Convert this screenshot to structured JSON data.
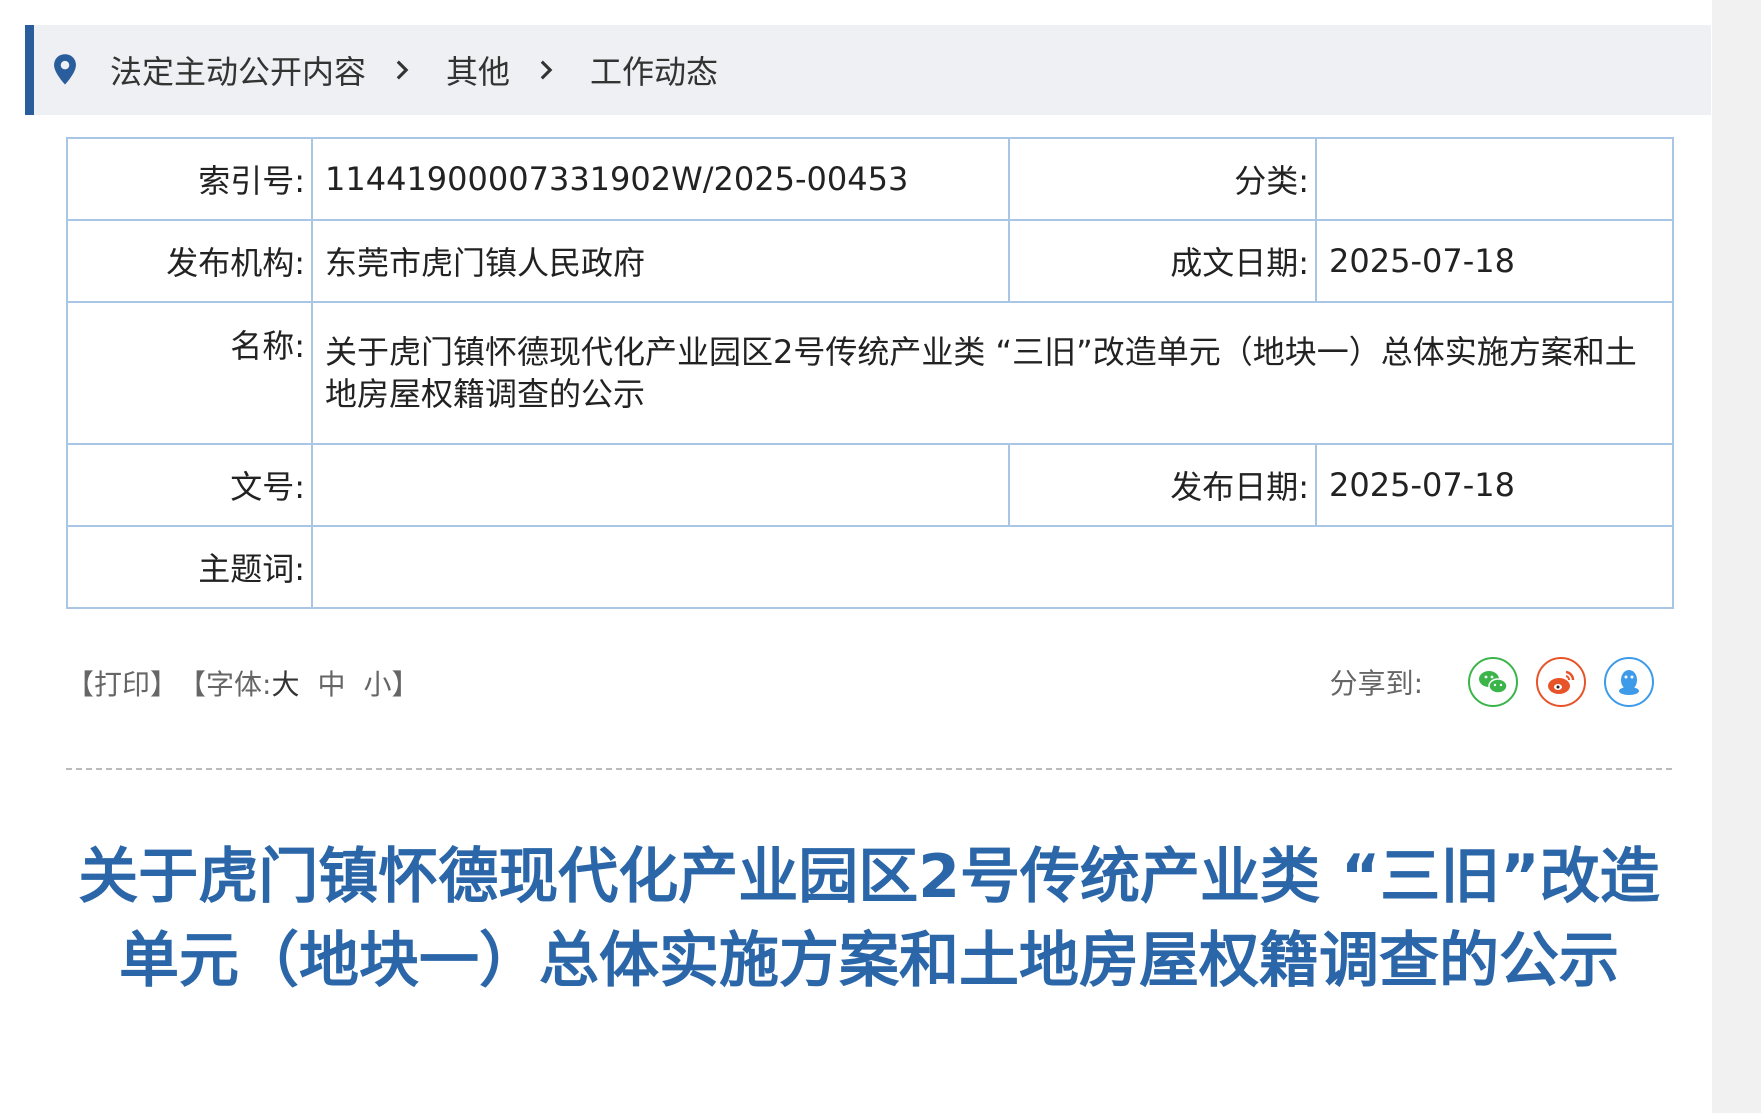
{
  "breadcrumb": {
    "items": [
      "法定主动公开内容",
      "其他",
      "工作动态"
    ]
  },
  "info": {
    "index_label": "索引号:",
    "index_value": "11441900007331902W/2025-00453",
    "category_label": "分类:",
    "category_value": "",
    "publisher_label": "发布机构:",
    "publisher_value": "东莞市虎门镇人民政府",
    "written_date_label": "成文日期:",
    "written_date_value": "2025-07-18",
    "name_label": "名称:",
    "name_value": "关于虎门镇怀德现代化产业园区2号传统产业类 “三旧”改造单元（地块一）总体实施方案和土地房屋权籍调查的公示",
    "doc_no_label": "文号:",
    "doc_no_value": "",
    "publish_date_label": "发布日期:",
    "publish_date_value": "2025-07-18",
    "keywords_label": "主题词:",
    "keywords_value": ""
  },
  "tools": {
    "print": "【打印】",
    "font_prefix": "【字体:",
    "font_large": "大",
    "font_medium": "中",
    "font_small": "小】",
    "share_label": "分享到:"
  },
  "icons": {
    "location": "location-pin-icon",
    "separator": "chevron-right-icon",
    "wechat": "wechat-icon",
    "weibo": "weibo-icon",
    "qq": "qq-icon"
  },
  "colors": {
    "accent": "#2a5d9c",
    "title": "#2a66a8",
    "table_border": "#a9c6e4",
    "wechat": "#3bb54a",
    "weibo": "#e8542a",
    "qq": "#3d9be9"
  },
  "title": "关于虎门镇怀德现代化产业园区2号传统产业类 “三旧”改造单元（地块一）总体实施方案和土地房屋权籍调查的公示"
}
